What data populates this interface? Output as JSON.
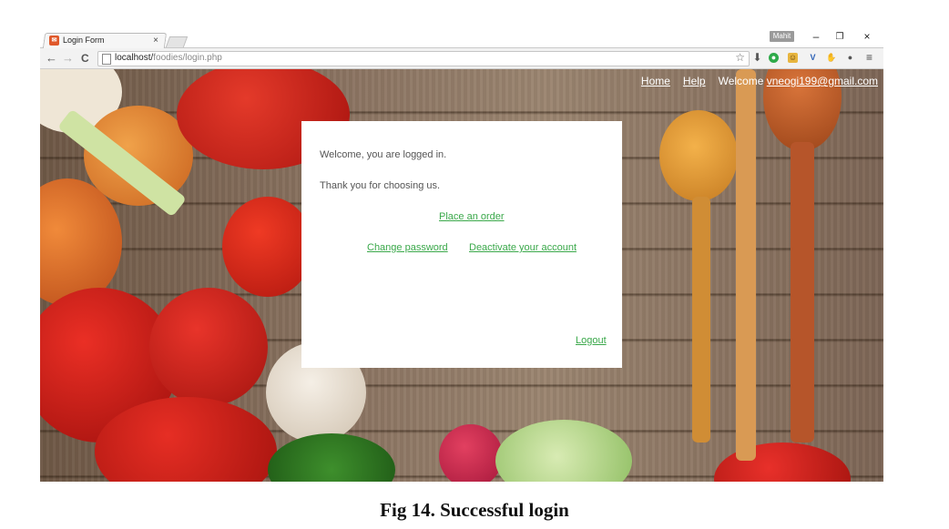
{
  "browser": {
    "tab_title": "Login Form",
    "tab_close": "×",
    "favicon": "favicon-icon",
    "profile_badge": "Mahit",
    "window_controls": {
      "minimize": "–",
      "restore": "❐",
      "close": "×"
    },
    "nav": {
      "back": "←",
      "forward": "→",
      "reload": "C"
    },
    "url_host": "localhost/",
    "url_path": "foodies/login.php",
    "bookmark_star": "☆",
    "extensions": [
      "download-icon",
      "green-circle-icon",
      "face-icon",
      "v-extension-icon",
      "hand-icon",
      "bulb-icon",
      "menu-icon"
    ]
  },
  "site_nav": {
    "home": "Home",
    "help": "Help",
    "welcome_prefix": "Welcome",
    "user_email": "vneogi199@gmail.com"
  },
  "card": {
    "welcome_text": "Welcome, you are logged in.",
    "thanks_text": "Thank you for choosing us.",
    "place_order": "Place an order",
    "change_password": "Change password",
    "deactivate": "Deactivate your account",
    "logout": "Logout"
  },
  "caption": "Fig 14. Successful login",
  "colors": {
    "link_green": "#3aa84a",
    "card_bg": "#ffffff",
    "wood": "#8a7361"
  }
}
